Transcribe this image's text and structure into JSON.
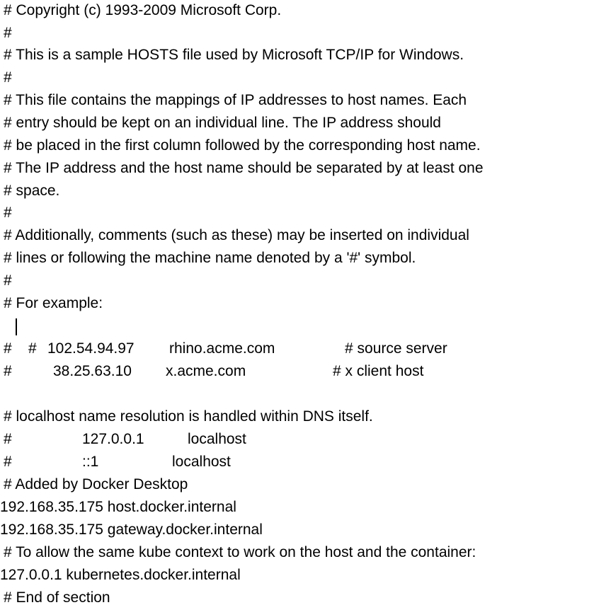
{
  "document": {
    "lines": [
      "# Copyright (c) 1993-2009 Microsoft Corp.",
      "#",
      "# This is a sample HOSTS file used by Microsoft TCP/IP for Windows.",
      "#",
      "# This file contains the mappings of IP addresses to host names. Each",
      "# entry should be kept on an individual line. The IP address should",
      "# be placed in the first column followed by the corresponding host name.",
      "# The IP address and the host name should be separated by at least one",
      "# space.",
      "#",
      "# Additionally, comments (such as these) may be inserted on individual",
      "# lines or following the machine name denoted by a '#' symbol.",
      "#",
      "# For example:",
      "#",
      "",
      "",
      "",
      "# localhost name resolution is handled within DNS itself.",
      "",
      "",
      "# Added by Docker Desktop",
      "192.168.35.175 host.docker.internal",
      "192.168.35.175 gateway.docker.internal",
      "# To allow the same kube context to work on the host and the container:",
      "127.0.0.1 kubernetes.docker.internal",
      "# End of section"
    ],
    "example_rows": [
      {
        "hash": "#",
        "ip": "102.54.94.97",
        "host": "rhino.acme.com",
        "comment": "# source server"
      },
      {
        "hash": "#",
        "ip": "38.25.63.10",
        "host": "x.acme.com",
        "comment": "# x client host"
      }
    ],
    "localhost_rows": [
      {
        "hash": "#",
        "ip": "127.0.0.1",
        "host": "localhost"
      },
      {
        "hash": "#",
        "ip": "::1",
        "host": "localhost"
      }
    ]
  }
}
